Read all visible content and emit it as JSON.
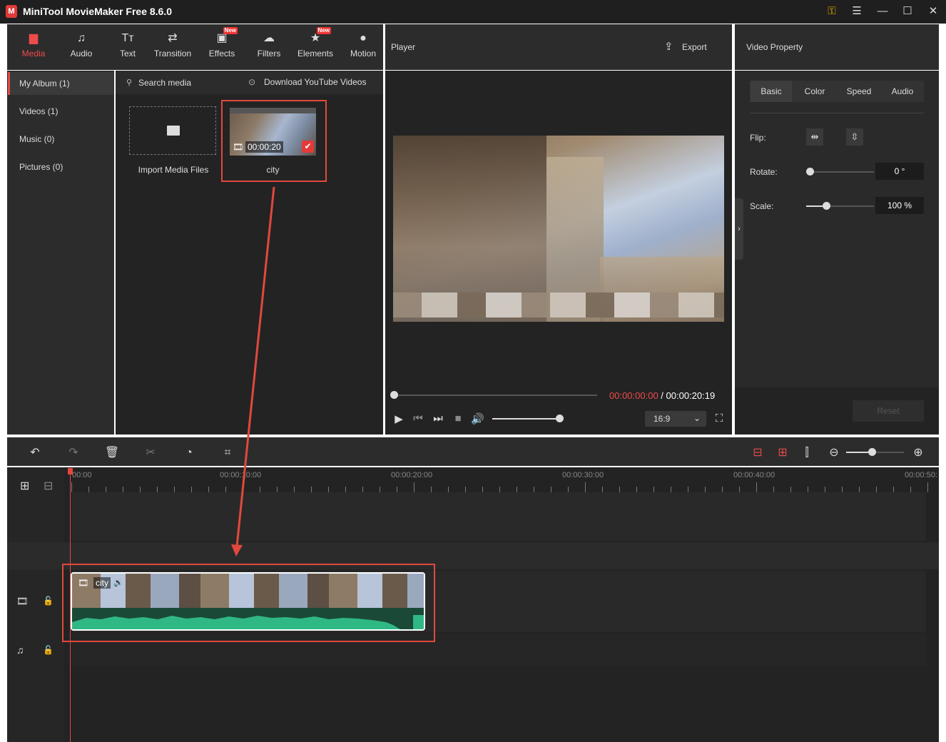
{
  "app": {
    "title": "MiniTool MovieMaker Free 8.6.0",
    "logo_glyph": "M"
  },
  "window_controls": [
    "key-icon",
    "menu-icon",
    "minimize-icon",
    "maximize-icon",
    "close-icon"
  ],
  "toolbar": {
    "items": [
      {
        "label": "Media",
        "icon": "folder-icon",
        "active": true
      },
      {
        "label": "Audio",
        "icon": "music-note-icon"
      },
      {
        "label": "Text",
        "icon": "text-icon"
      },
      {
        "label": "Transition",
        "icon": "transition-arrows-icon"
      },
      {
        "label": "Effects",
        "icon": "effects-icon",
        "badge": "New"
      },
      {
        "label": "Filters",
        "icon": "filters-icon"
      },
      {
        "label": "Elements",
        "icon": "elements-icon",
        "badge": "New"
      },
      {
        "label": "Motion",
        "icon": "motion-icon"
      }
    ]
  },
  "sidebar": {
    "items": [
      {
        "label": "My Album (1)",
        "active": true
      },
      {
        "label": "Videos (1)"
      },
      {
        "label": "Music (0)"
      },
      {
        "label": "Pictures (0)"
      }
    ]
  },
  "media": {
    "search_placeholder": "Search media",
    "download_label": "Download YouTube Videos",
    "import_label": "Import Media Files",
    "clip": {
      "name": "city",
      "duration": "00:00:20"
    }
  },
  "player": {
    "title": "Player",
    "export_label": "Export",
    "current_time": "00:00:00:00",
    "separator": " / ",
    "total_time": "00:00:20:19",
    "aspect_ratio": "16:9",
    "progress": 0.0,
    "volume": 1.0
  },
  "property": {
    "title": "Video Property",
    "tabs": [
      {
        "label": "Basic",
        "active": true
      },
      {
        "label": "Color"
      },
      {
        "label": "Speed"
      },
      {
        "label": "Audio"
      }
    ],
    "flip_label": "Flip:",
    "rotate_label": "Rotate:",
    "rotate_value": "0 °",
    "rotate_level": 0.0,
    "scale_label": "Scale:",
    "scale_value": "100 %",
    "scale_level": 0.29,
    "reset_label": "Reset"
  },
  "timeline": {
    "ticks": [
      "00:00",
      "00:00:10:00",
      "00:00:20:00",
      "00:00:30:00",
      "00:00:40:00",
      "00:00:50:"
    ],
    "clip_name": "city",
    "zoom_level": 0.45
  },
  "colors": {
    "accent": "#e34a4a",
    "panel": "#2c2c2c",
    "dark": "#232323",
    "waveform": "#2fb884",
    "highlight": "#e2483d"
  }
}
